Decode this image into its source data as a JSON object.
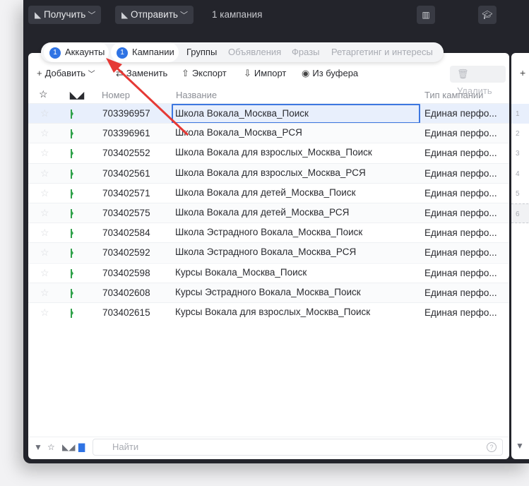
{
  "topbar": {
    "get_label": "Получить",
    "send_label": "Отправить",
    "campaign_count": "1 кампания"
  },
  "tabs": [
    {
      "label": "Аккаунты",
      "badge": "1",
      "state": "active"
    },
    {
      "label": "Кампании",
      "badge": "1",
      "state": "active"
    },
    {
      "label": "Группы",
      "state": "active"
    },
    {
      "label": "Объявления",
      "state": "disabled"
    },
    {
      "label": "Фразы",
      "state": "disabled"
    },
    {
      "label": "Ретаргетинг и интересы",
      "state": "disabled"
    }
  ],
  "toolbar": {
    "add_label": "Добавить",
    "replace_label": "Заменить",
    "export_label": "Экспорт",
    "import_label": "Импорт",
    "clipboard_label": "Из буфера",
    "delete_label": "Удалить"
  },
  "table": {
    "columns": {
      "number": "Номер",
      "name": "Название",
      "type": "Тип кампании"
    },
    "rows": [
      {
        "number": "703396957",
        "name": "Школа Вокала_Москва_Поиск",
        "type": "Единая перфо..."
      },
      {
        "number": "703396961",
        "name": "Школа Вокала_Москва_РСЯ",
        "type": "Единая перфо..."
      },
      {
        "number": "703402552",
        "name": "Школа Вокала для взрослых_Москва_Поиск",
        "type": "Единая перфо..."
      },
      {
        "number": "703402561",
        "name": "Школа Вокала для взрослых_Москва_РСЯ",
        "type": "Единая перфо..."
      },
      {
        "number": "703402571",
        "name": "Школа Вокала для детей_Москва_Поиск",
        "type": "Единая перфо..."
      },
      {
        "number": "703402575",
        "name": "Школа Вокала для детей_Москва_РСЯ",
        "type": "Единая перфо..."
      },
      {
        "number": "703402584",
        "name": "Школа Эстрадного Вокала_Москва_Поиск",
        "type": "Единая перфо..."
      },
      {
        "number": "703402592",
        "name": "Школа Эстрадного Вокала_Москва_РСЯ",
        "type": "Единая перфо..."
      },
      {
        "number": "703402598",
        "name": "Курсы Вокала_Москва_Поиск",
        "type": "Единая перфо..."
      },
      {
        "number": "703402608",
        "name": "Курсы Эстрадного Вокала_Москва_Поиск",
        "type": "Единая перфо..."
      },
      {
        "number": "703402615",
        "name": "Курсы Вокала для взрослых_Москва_Поиск",
        "type": "Единая перфо..."
      }
    ]
  },
  "search": {
    "placeholder": "Найти"
  },
  "side_panel": {
    "row_numbers": [
      "1",
      "2",
      "3",
      "4",
      "5",
      "6"
    ]
  },
  "colors": {
    "accent": "#2f73e4",
    "annotation_arrow": "#e53935",
    "status_green": "#2fa24a"
  }
}
